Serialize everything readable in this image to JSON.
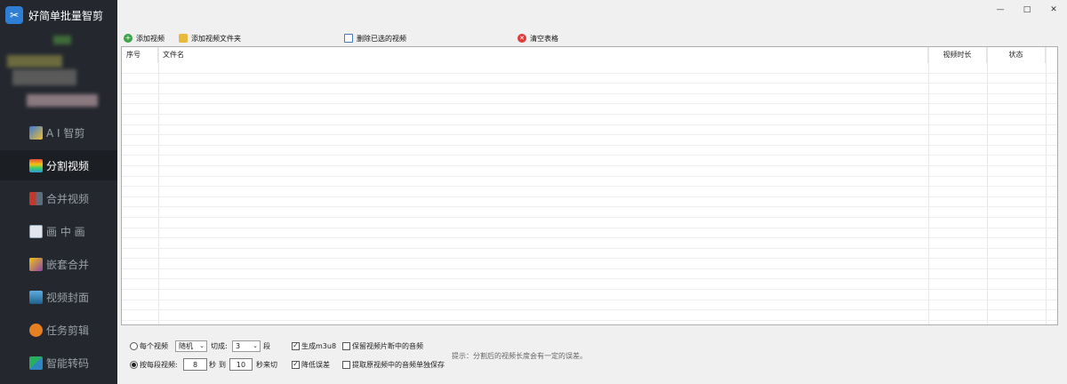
{
  "app": {
    "title": "好简单批量智剪"
  },
  "window_controls": {
    "minimize": "—",
    "maximize": "□",
    "close": "✕"
  },
  "nav": [
    {
      "label": "A I 智剪",
      "icon": "ai-magic-icon",
      "active": false
    },
    {
      "label": "分割视频",
      "icon": "split-video-icon",
      "active": true
    },
    {
      "label": "合并视频",
      "icon": "merge-video-icon",
      "active": false
    },
    {
      "label": "画 中 画",
      "icon": "picture-in-picture-icon",
      "active": false
    },
    {
      "label": "嵌套合并",
      "icon": "nest-merge-icon",
      "active": false
    },
    {
      "label": "视频封面",
      "icon": "video-cover-icon",
      "active": false
    },
    {
      "label": "任务剪辑",
      "icon": "task-edit-icon",
      "active": false
    },
    {
      "label": "智能转码",
      "icon": "transcode-icon",
      "active": false
    }
  ],
  "toolbar": {
    "add_video": "添加视频",
    "add_folder": "添加视频文件夹",
    "delete_selected": "删除已选的视频",
    "clear_table": "清空表格"
  },
  "table": {
    "columns": [
      "序号",
      "文件名",
      "视频时长",
      "状态"
    ],
    "rows": []
  },
  "options": {
    "per_video_label": "每个视频",
    "mode_value": "随机",
    "cut_into_label": "切成:",
    "segments_value": "3",
    "segments_unit": "段",
    "per_segment_label": "按每段视频:",
    "from_value": "8",
    "seconds_label": "秒",
    "to_label": "到",
    "to_value": "10",
    "seconds_end_label": "秒来切",
    "generate_m3u8": "生成m3u8",
    "reduce_error": "降低误差",
    "keep_audio": "保留视频片断中的音频",
    "extract_audio": "提取原视频中的音频单独保存",
    "hint": "提示：分割后的视频长度会有一定的误差。"
  },
  "state": {
    "per_video_selected": false,
    "per_segment_selected": true,
    "generate_m3u8_checked": true,
    "reduce_error_checked": true,
    "keep_audio_checked": false,
    "extract_audio_checked": false
  }
}
